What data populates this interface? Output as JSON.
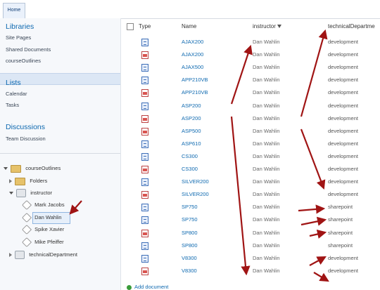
{
  "topbar": {
    "tab": "Home"
  },
  "quicklaunch": {
    "libraries": {
      "heading": "Libraries",
      "items": [
        "Site Pages",
        "Shared Documents",
        "courseOutlines"
      ]
    },
    "lists": {
      "heading": "Lists",
      "items": [
        "Calendar",
        "Tasks"
      ]
    },
    "discussions": {
      "heading": "Discussions",
      "items": [
        "Team Discussion"
      ]
    }
  },
  "tree": {
    "root": "courseOutlines",
    "folders": "Folders",
    "instructor": "instructor",
    "instructors": [
      "Mark Jacobs",
      "Dan Wahlin",
      "Spike Xavier",
      "Mike Pfeiffer"
    ],
    "technicalDepartment": "technicalDepartment"
  },
  "list": {
    "headers": {
      "type": "Type",
      "name": "Name",
      "instructor": "instructor",
      "dept": "technicalDepartme"
    },
    "rows": [
      {
        "type": "doc",
        "name": "AJAX200",
        "instructor": "Dan Wahlin",
        "dept": "development"
      },
      {
        "type": "pdf",
        "name": "AJAX200",
        "instructor": "Dan Wahlin",
        "dept": "development"
      },
      {
        "type": "doc",
        "name": "AJAX500",
        "instructor": "Dan Wahlin",
        "dept": "development"
      },
      {
        "type": "doc",
        "name": "APP210VB",
        "instructor": "Dan Wahlin",
        "dept": "development"
      },
      {
        "type": "pdf",
        "name": "APP210VB",
        "instructor": "Dan Wahlin",
        "dept": "development"
      },
      {
        "type": "doc",
        "name": "ASP200",
        "instructor": "Dan Wahlin",
        "dept": "development"
      },
      {
        "type": "pdf",
        "name": "ASP200",
        "instructor": "Dan Wahlin",
        "dept": "development"
      },
      {
        "type": "pdf",
        "name": "ASP500",
        "instructor": "Dan Wahlin",
        "dept": "development"
      },
      {
        "type": "doc",
        "name": "ASP610",
        "instructor": "Dan Wahlin",
        "dept": "development"
      },
      {
        "type": "doc",
        "name": "CS300",
        "instructor": "Dan Wahlin",
        "dept": "development"
      },
      {
        "type": "pdf",
        "name": "CS300",
        "instructor": "Dan Wahlin",
        "dept": "development"
      },
      {
        "type": "doc",
        "name": "SILVER200",
        "instructor": "Dan Wahlin",
        "dept": "development"
      },
      {
        "type": "pdf",
        "name": "SILVER200",
        "instructor": "Dan Wahlin",
        "dept": "development"
      },
      {
        "type": "doc",
        "name": "SP750",
        "instructor": "Dan Wahlin",
        "dept": "sharepoint"
      },
      {
        "type": "doc",
        "name": "SP750",
        "instructor": "Dan Wahlin",
        "dept": "sharepoint"
      },
      {
        "type": "pdf",
        "name": "SP800",
        "instructor": "Dan Wahlin",
        "dept": "sharepoint"
      },
      {
        "type": "doc",
        "name": "SP800",
        "instructor": "Dan Wahlin",
        "dept": "sharepoint"
      },
      {
        "type": "doc",
        "name": "V8300",
        "instructor": "Dan Wahlin",
        "dept": "development"
      },
      {
        "type": "pdf",
        "name": "V8300",
        "instructor": "Dan Wahlin",
        "dept": "development"
      }
    ],
    "add_label": "Add document"
  },
  "colors": {
    "link": "#0e69b0",
    "arrow": "#a01414",
    "selected": "#dce7f5"
  },
  "icons": {
    "doc": "word-document-icon",
    "pdf": "pdf-document-icon",
    "filter": "filter-funnel-icon"
  }
}
